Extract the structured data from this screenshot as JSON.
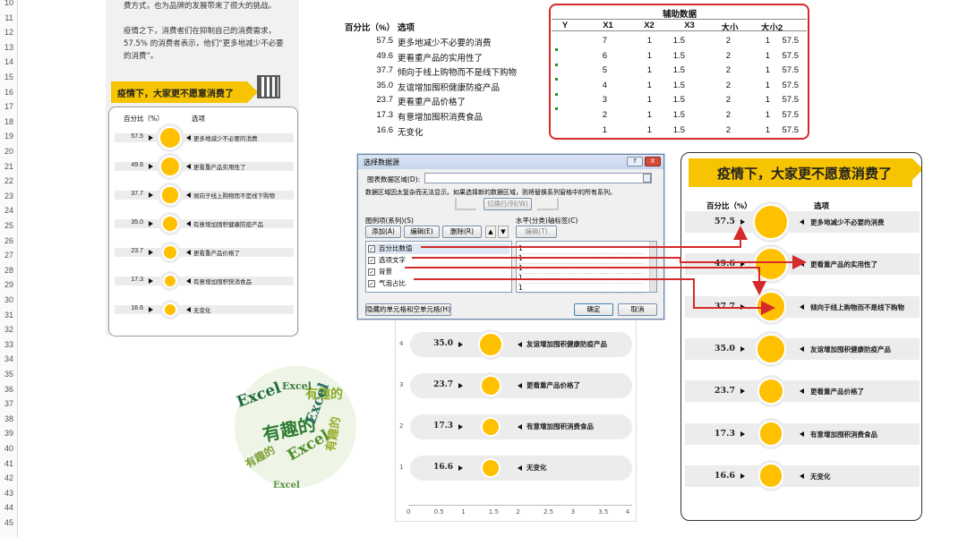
{
  "row_numbers": [
    "10",
    "11",
    "12",
    "13",
    "14",
    "15",
    "16",
    "17",
    "18",
    "19",
    "20",
    "21",
    "22",
    "23",
    "24",
    "25",
    "26",
    "27",
    "28",
    "29",
    "30",
    "31",
    "32",
    "33",
    "34",
    "35",
    "36",
    "37",
    "38",
    "39",
    "40",
    "41",
    "42",
    "43",
    "44",
    "45"
  ],
  "intro": {
    "line1": "费方式，也为品牌的发展带来了很大的挑战。",
    "line2": "疫情之下，消费者们在抑制自己的消费需求，",
    "line3": "57.5% 的消费者表示，他们“更多地减少不必要",
    "line4": "的消费”。"
  },
  "banner_title": "疫情下，大家更不愿意消费了",
  "col_pct": "百分比（%）",
  "col_item": "选项",
  "items": [
    {
      "pct": "57.5",
      "label": "更多地减少不必要的消费",
      "value": 57.5
    },
    {
      "pct": "49.6",
      "label": "更看重产品的实用性了",
      "value": 49.6
    },
    {
      "pct": "37.7",
      "label": "倾向于线上购物而不是线下购物",
      "value": 37.7
    },
    {
      "pct": "35.0",
      "label": "友谊增加囤积健康防疫产品",
      "value": 35.0
    },
    {
      "pct": "23.7",
      "label": "更看重产品价格了",
      "value": 23.7
    },
    {
      "pct": "17.3",
      "label": "有意增加囤积消费食品",
      "value": 17.3
    },
    {
      "pct": "16.6",
      "label": "无变化",
      "value": 16.6
    }
  ],
  "left_chart": {
    "col_pct": "百分比（%）",
    "col_item": "选项",
    "labels": [
      "更多地减少不必要的消费",
      "更看重产品实用性了",
      "倾向于线上购物而不是线下购物",
      "有意增加囤积健康防疫产品",
      "更看重产品价格了",
      "有意增加囤积快消食品",
      "无变化"
    ]
  },
  "table": {
    "col_pct": "百分比（%）",
    "col_item": "选项",
    "aux_title": "辅助数据",
    "aux_headers": [
      "Y",
      "X1",
      "X2",
      "X3",
      "大小",
      "大小2"
    ],
    "labels": [
      "更多地减少不必要的消费",
      "更看重产品的实用性了",
      "倾向于线上购物而不是线下购物",
      "友谊增加囤积健康防疫产品",
      "更看重产品价格了",
      "有意增加囤积消费食品",
      "无变化"
    ],
    "aux_rows": [
      [
        "7",
        "1",
        "1.5",
        "2",
        "1",
        "57.5"
      ],
      [
        "6",
        "1",
        "1.5",
        "2",
        "1",
        "57.5"
      ],
      [
        "5",
        "1",
        "1.5",
        "2",
        "1",
        "57.5"
      ],
      [
        "4",
        "1",
        "1.5",
        "2",
        "1",
        "57.5"
      ],
      [
        "3",
        "1",
        "1.5",
        "2",
        "1",
        "57.5"
      ],
      [
        "2",
        "1",
        "1.5",
        "2",
        "1",
        "57.5"
      ],
      [
        "1",
        "1",
        "1.5",
        "2",
        "1",
        "57.5"
      ]
    ]
  },
  "dialog": {
    "title": "选择数据源",
    "help": "?",
    "close": "X",
    "range_label": "图表数据区域(D):",
    "note": "数据区域因太复杂而无法显示。如果选择新的数据区域，则将替换系列窗格中的所有系列。",
    "switch_btn": "切换行/列(W)",
    "series_label": "图例项(系列)(S)",
    "axis_label": "水平(分类)轴标签(C)",
    "add_btn": "添加(A)",
    "edit_btn": "编辑(E)",
    "delete_btn": "删除(R)",
    "axis_edit_btn": "编辑(T)",
    "series": [
      "百分比数值",
      "选项文字",
      "背景",
      "气泡占比"
    ],
    "axis_values": [
      "1",
      "1",
      "1",
      "1",
      "1"
    ],
    "hidden_btn": "隐藏的单元格和空单元格(H)",
    "ok_btn": "确定",
    "cancel_btn": "取消"
  },
  "mid_chart": {
    "ytick_labels": [
      "4",
      "3",
      "2",
      "1"
    ],
    "xtick_labels": [
      "0",
      "0.5",
      "1",
      "1.5",
      "2",
      "2.5",
      "3",
      "3.5",
      "4"
    ]
  },
  "word_cloud": {
    "words": [
      "Excel",
      "有趣的",
      "Excel",
      "有趣的",
      "Excel",
      "有趣的",
      "Excel",
      "有趣的",
      "Excel"
    ]
  },
  "colors": {
    "accent": "#ffc000",
    "banner": "#f6c400",
    "highlight": "#d42a2a"
  }
}
